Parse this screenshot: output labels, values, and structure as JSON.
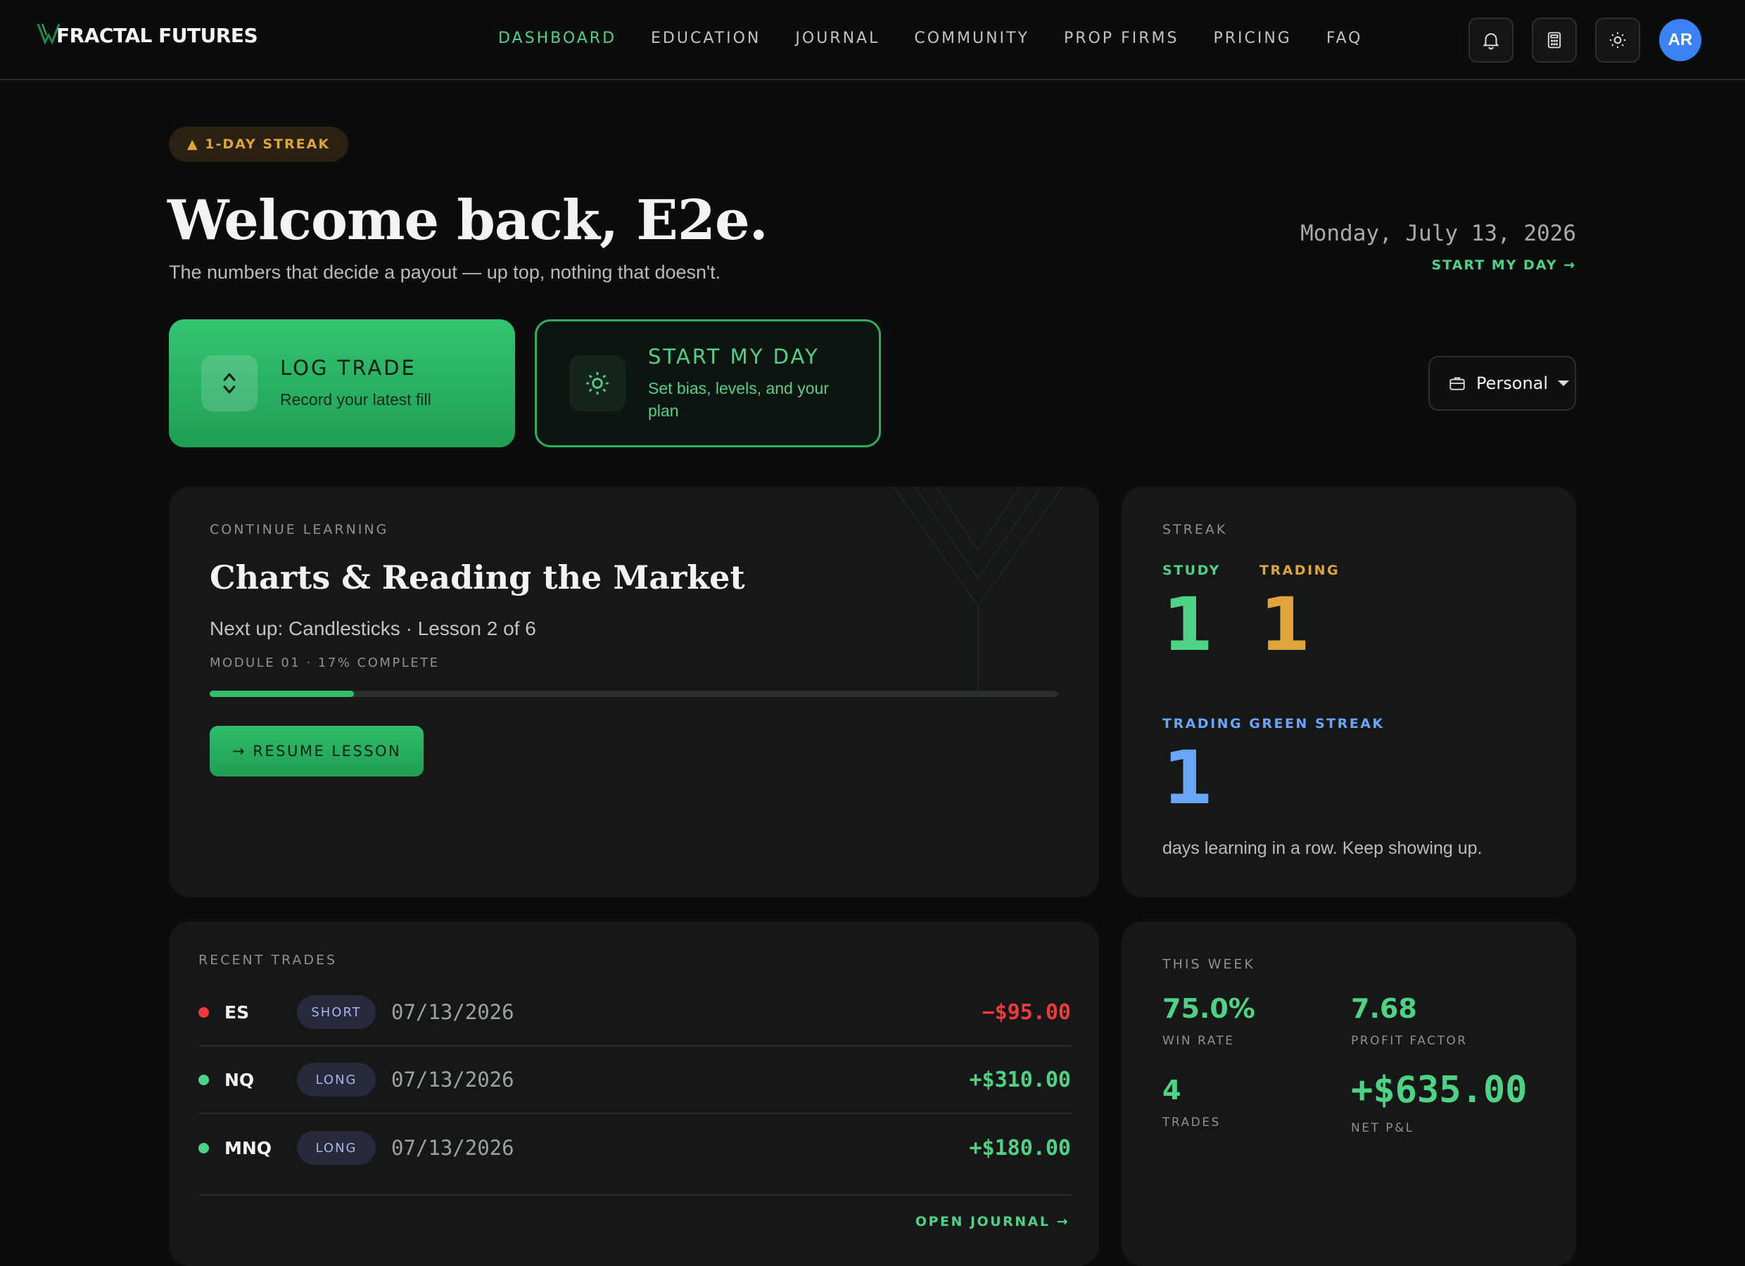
{
  "brand": {
    "name": "FRACTAL FUTURES"
  },
  "nav": [
    {
      "label": "DASHBOARD",
      "active": true
    },
    {
      "label": "EDUCATION",
      "active": false
    },
    {
      "label": "JOURNAL",
      "active": false
    },
    {
      "label": "COMMUNITY",
      "active": false
    },
    {
      "label": "PROP FIRMS",
      "active": false
    },
    {
      "label": "PRICING",
      "active": false
    },
    {
      "label": "FAQ",
      "active": false
    }
  ],
  "header_icons": [
    "bell-icon",
    "calculator-icon",
    "sun-icon"
  ],
  "user": {
    "initials": "AR",
    "avatar_color": "#3b82f6"
  },
  "hero": {
    "streak_badge": "▲ 1-DAY STREAK",
    "welcome": "Welcome back, E2e.",
    "subtitle": "The numbers that decide a payout — up top, nothing that doesn't.",
    "date": "Monday, July 13, 2026",
    "start_link": "START MY DAY →"
  },
  "actions": {
    "log": {
      "title": "LOG TRADE",
      "desc": "Record your latest fill",
      "icon": "up-down-diamond-icon"
    },
    "day": {
      "title": "START MY DAY",
      "desc": "Set bias, levels, and your plan",
      "icon": "sun-icon"
    }
  },
  "account": {
    "label": "Personal",
    "icon": "briefcase-icon"
  },
  "learning": {
    "section": "CONTINUE LEARNING",
    "course": "Charts & Reading the Market",
    "next_up": "Next up: Candlesticks · Lesson 2 of 6",
    "module": "MODULE 01 · 17% COMPLETE",
    "progress": 0.17,
    "button": "→ RESUME LESSON"
  },
  "streak": {
    "section": "STREAK",
    "study_label": "STUDY",
    "study_value": "1",
    "trading_label": "TRADING",
    "trading_value": "1",
    "green_label": "TRADING GREEN STREAK",
    "green_value": "1",
    "note": "days learning in a row. Keep showing up."
  },
  "trades": {
    "section": "RECENT TRADES",
    "rows": [
      {
        "symbol": "ES",
        "side": "SHORT",
        "date": "07/13/2026",
        "pnl": "−$95.00",
        "color": "#ef3b3b"
      },
      {
        "symbol": "NQ",
        "side": "LONG",
        "date": "07/13/2026",
        "pnl": "+$310.00",
        "color": "#4ed386"
      },
      {
        "symbol": "MNQ",
        "side": "LONG",
        "date": "07/13/2026",
        "pnl": "+$180.00",
        "color": "#4ed386"
      }
    ],
    "open_journal": "OPEN JOURNAL →"
  },
  "week": {
    "section": "THIS WEEK",
    "win_rate": "75.0%",
    "win_rate_label": "WIN RATE",
    "profit_factor": "7.68",
    "profit_factor_label": "PROFIT FACTOR",
    "trades": "4",
    "trades_label": "TRADES",
    "net_pnl": "+$635.00",
    "net_pnl_label": "NET P&L"
  },
  "colors": {
    "accent": "#4ed386",
    "study": "#4ed386",
    "trading": "#e0a53a",
    "green_streak": "#6aa6f7",
    "loss": "#ef3b3b"
  }
}
